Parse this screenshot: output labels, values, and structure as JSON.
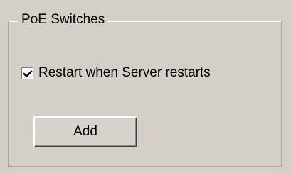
{
  "group": {
    "title": "PoE Switches"
  },
  "restart_option": {
    "label": "Restart when Server restarts",
    "checked": true
  },
  "add_button": {
    "label": "Add"
  },
  "icons": {
    "checkbox_mark": "checkmark-icon"
  },
  "colors": {
    "background": "#d4d0c8",
    "border_dark": "#404040",
    "border_light": "#ffffff",
    "checkbox_fill": "#ffffff"
  }
}
